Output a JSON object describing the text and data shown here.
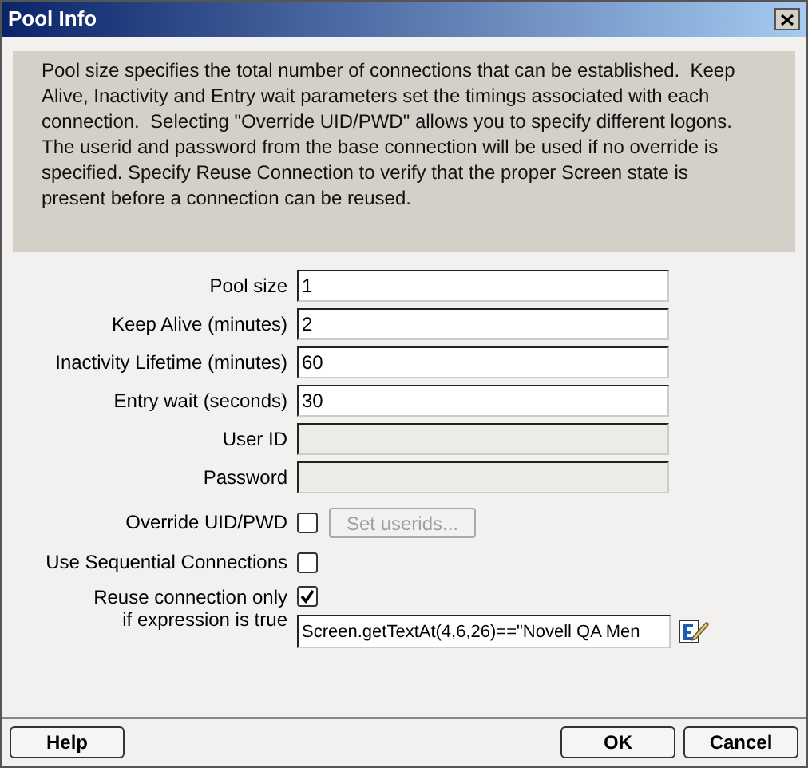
{
  "window": {
    "title": "Pool Info"
  },
  "description": "Pool size specifies the total number of connections that can be established.  Keep Alive, Inactivity and Entry wait parameters set the timings associated with each connection.  Selecting \"Override UID/PWD\" allows you to specify different logons. The userid and password from the base connection will be used if no override is specified. Specify Reuse Connection to verify that the proper Screen state is present before a connection can be reused.",
  "fields": [
    {
      "kind": "text",
      "label": "Pool size",
      "value": "1",
      "disabled": false
    },
    {
      "kind": "text",
      "label": "Keep Alive (minutes)",
      "value": "2",
      "disabled": false
    },
    {
      "kind": "text",
      "label": "Inactivity Lifetime (minutes)",
      "value": "60",
      "disabled": false
    },
    {
      "kind": "text",
      "label": "Entry wait (seconds)",
      "value": "30",
      "disabled": false
    },
    {
      "kind": "text",
      "label": "User ID",
      "disabled": true
    },
    {
      "kind": "text",
      "label": "Password",
      "disabled": true
    },
    {
      "kind": "checkbox",
      "label": "Override UID/PWD",
      "checked": false,
      "button": {
        "label": "Set userids...",
        "disabled": true
      }
    },
    {
      "kind": "checkbox",
      "label": "Use Sequential Connections",
      "checked": false
    },
    {
      "kind": "expression",
      "label_lines": [
        "Reuse connection only",
        "if expression is true"
      ],
      "checked": true,
      "value": "Screen.getTextAt(4,6,26)==\"Novell QA Men"
    }
  ],
  "buttons": [
    {
      "label": "Help"
    },
    {
      "label": "OK"
    },
    {
      "label": "Cancel"
    }
  ]
}
